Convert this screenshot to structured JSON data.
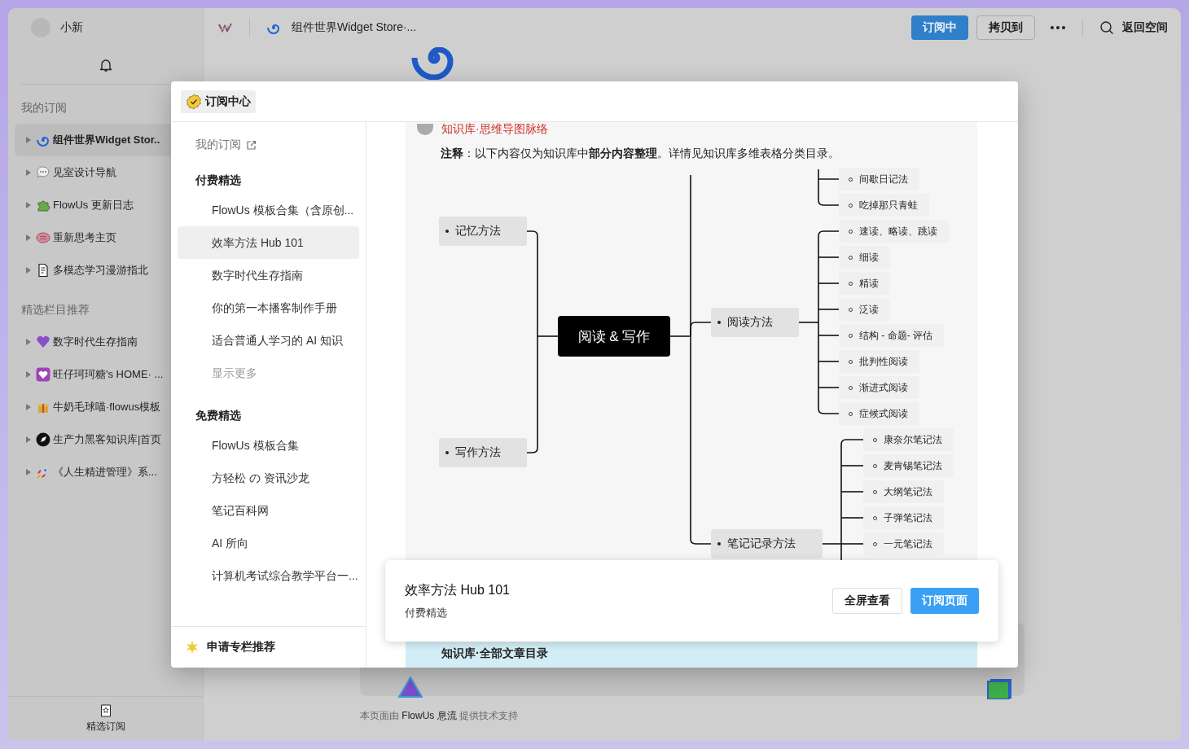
{
  "user": {
    "name": "小新"
  },
  "sidebar": {
    "sections": [
      {
        "title": "我的订阅",
        "items": [
          {
            "label": "组件世界Widget Stor..",
            "selected": true
          },
          {
            "label": "见室设计导航",
            "selected": false
          },
          {
            "label": "FlowUs 更新日志",
            "selected": false
          },
          {
            "label": "重新思考主页",
            "selected": false
          },
          {
            "label": "多模态学习漫游指北",
            "selected": false
          }
        ]
      },
      {
        "title": "精选栏目推荐",
        "items": [
          {
            "label": "数字时代生存指南",
            "selected": false
          },
          {
            "label": "旺仔珂珂糖's HOME· ...",
            "selected": false
          },
          {
            "label": "牛奶毛球喵·flowus模板",
            "selected": false
          },
          {
            "label": "生产力黑客知识库|首页",
            "selected": false
          },
          {
            "label": "《人生精进管理》系...",
            "selected": false
          }
        ]
      }
    ],
    "footer_link": "精选订阅"
  },
  "topbar": {
    "page_title": "组件世界Widget Store·...",
    "buttons": [
      {
        "label": "订阅中",
        "kind": "primary"
      },
      {
        "label": "拷贝到",
        "kind": "outline"
      }
    ],
    "back_link": "返回空间"
  },
  "modal": {
    "title": "订阅中心",
    "my_subscriptions": "我的订阅",
    "groups": [
      {
        "title": "付费精选",
        "items": [
          {
            "label": "FlowUs 模板合集（含原创...",
            "selected": false
          },
          {
            "label": "效率方法 Hub 101",
            "selected": true
          },
          {
            "label": "数字时代生存指南",
            "selected": false
          },
          {
            "label": "你的第一本播客制作手册",
            "selected": false
          },
          {
            "label": "适合普通人学习的 AI 知识",
            "selected": false
          }
        ],
        "more": "显示更多"
      },
      {
        "title": "免费精选",
        "items": [
          {
            "label": "FlowUs 模板合集",
            "selected": false
          },
          {
            "label": "方轻松 の 资讯沙龙",
            "selected": false
          },
          {
            "label": "笔记百科网",
            "selected": false
          },
          {
            "label": "AI 所向",
            "selected": false
          },
          {
            "label": "计算机考试综合教学平台一...",
            "selected": false
          }
        ]
      }
    ],
    "apply": "申请专栏推荐",
    "preview": {
      "heading": "知识库·思维导图脉络",
      "note": "**注释**：以下内容仅为知识库中**部分内容整理**。详情见知识库多维表格分类目录。",
      "mindmap": {
        "root": "阅读 & 写作",
        "upper_leaves": [
          "间歇日记法",
          "吃掉那只青蛙"
        ],
        "left_branches": [
          {
            "label": "记忆方法"
          },
          {
            "label": "写作方法"
          }
        ],
        "right_branches": [
          {
            "label": "阅读方法",
            "children": [
              {
                "label": "速读、略读、跳读"
              },
              {
                "label": "细读"
              },
              {
                "label": "精读"
              },
              {
                "label": "泛读"
              },
              {
                "label": "结构 - 命题- 评估"
              },
              {
                "label": "批判性阅读"
              },
              {
                "label": "渐进式阅读"
              },
              {
                "label": "症候式阅读"
              }
            ]
          },
          {
            "label": "笔记记录方法",
            "children": [
              {
                "label": "康奈尔笔记法"
              },
              {
                "label": "麦肯锡笔记法"
              },
              {
                "label": "大纲笔记法"
              },
              {
                "label": "子弹笔记法"
              },
              {
                "label": "一元笔记法"
              }
            ]
          }
        ]
      },
      "banner": "知识库·全部文章目录"
    },
    "card": {
      "title": "效率方法 Hub 101",
      "subtitle": "付费精选",
      "buttons": [
        {
          "label": "全屏查看",
          "kind": "outline"
        },
        {
          "label": "订阅页面",
          "kind": "primary"
        }
      ]
    }
  },
  "footer": "本页面由 **FlowUs 息流** 提供技术支持"
}
